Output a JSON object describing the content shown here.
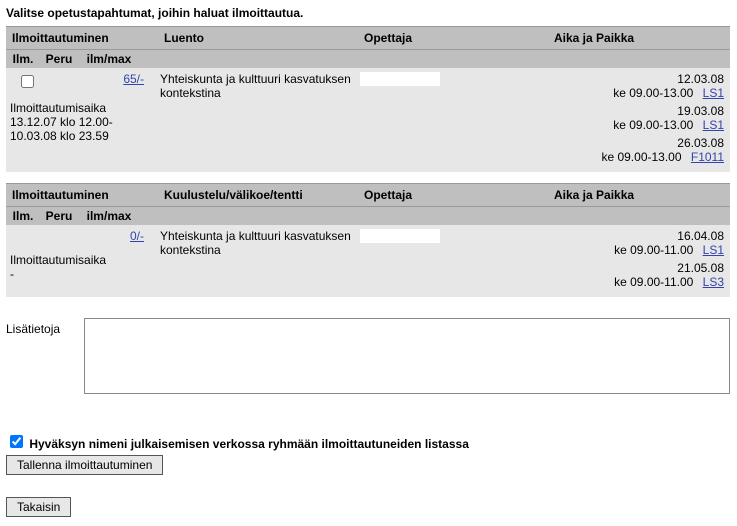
{
  "instruction": "Valitse opetustapahtumat, joihin haluat ilmoittautua.",
  "headers": {
    "registration": "Ilmoittautuminen",
    "teacher": "Opettaja",
    "time_place": "Aika ja Paikka",
    "sub_ilm": "Ilm.",
    "sub_peru": "Peru",
    "sub_ilmmax": "ilm/max"
  },
  "sections": [
    {
      "type_label": "Luento",
      "course_name": "Yhteiskunta ja kulttuuri kasvatuksen kontekstina",
      "capacity_link": "65/-",
      "reg_period_label": "Ilmoittautumisaika",
      "reg_period_value": "13.12.07 klo 12.00-10.03.08 klo 23.59",
      "schedule": [
        {
          "date": "12.03.08",
          "time": "ke 09.00-13.00",
          "loc": "LS1"
        },
        {
          "date": "19.03.08",
          "time": "ke 09.00-13.00",
          "loc": "LS1"
        },
        {
          "date": "26.03.08",
          "time": "ke 09.00-13.00",
          "loc": "F1011"
        }
      ]
    },
    {
      "type_label": "Kuulustelu/välikoe/tentti",
      "course_name": "Yhteiskunta ja kulttuuri kasvatuksen kontekstina",
      "capacity_link": "0/-",
      "reg_period_label": "Ilmoittautumisaika",
      "reg_period_value": "-",
      "schedule": [
        {
          "date": "16.04.08",
          "time": "ke 09.00-11.00",
          "loc": "LS1"
        },
        {
          "date": "21.05.08",
          "time": "ke 09.00-11.00",
          "loc": "LS3"
        }
      ]
    }
  ],
  "info_label": "Lisätietoja",
  "consent_label": "Hyväksyn nimeni julkaisemisen verkossa ryhmään ilmoittautuneiden listassa",
  "save_button": "Tallenna ilmoittautuminen",
  "back_button": "Takaisin"
}
